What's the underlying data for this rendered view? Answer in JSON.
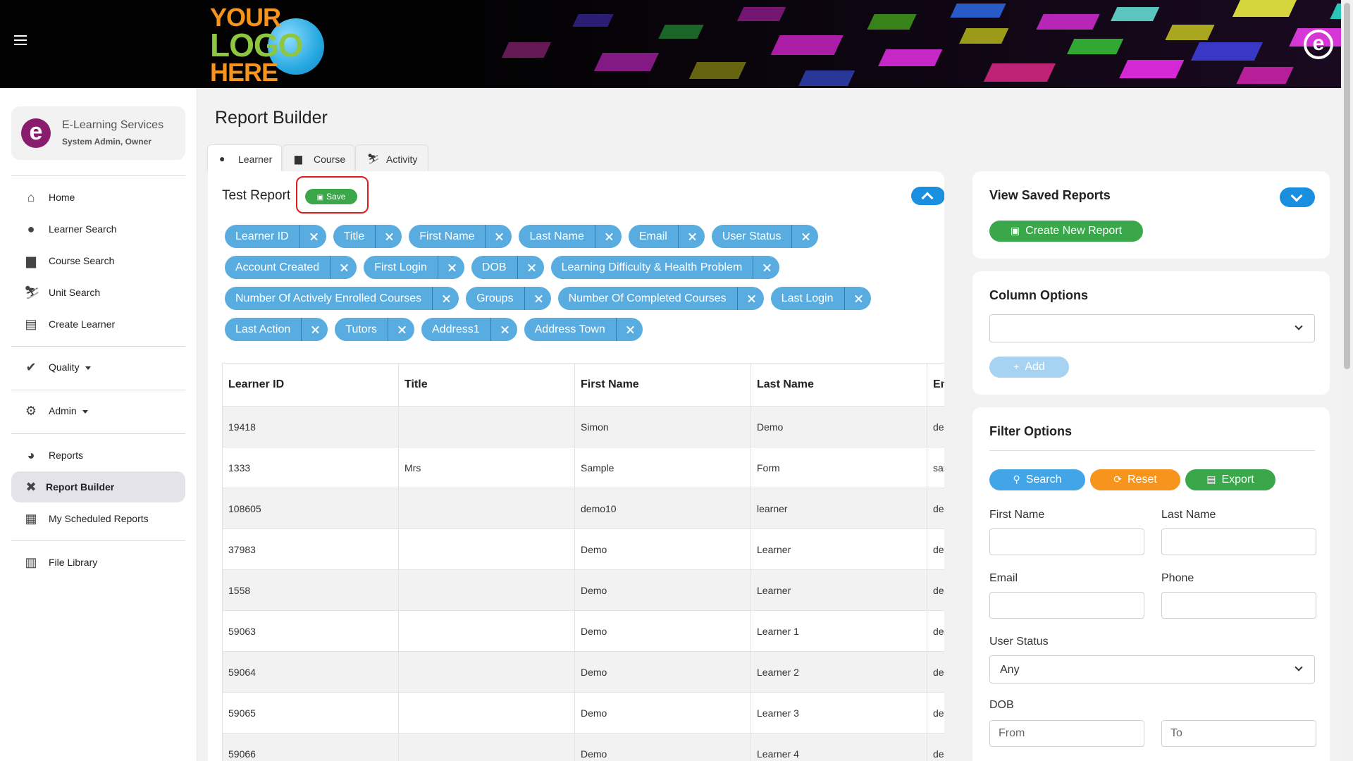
{
  "header": {
    "menu_icon": "hamburger-icon",
    "logo": {
      "line1": "YOUR",
      "line2": "LOGO",
      "line3": "HERE"
    },
    "brand_icon": "e-learning-logo-icon"
  },
  "sidebar": {
    "user": {
      "avatar_letter": "e",
      "org": "E-Learning Services",
      "role": "System Admin, Owner"
    },
    "items": [
      {
        "label": "Home",
        "icon": "home-icon",
        "glyph": "⌂"
      },
      {
        "label": "Learner Search",
        "icon": "user-circle-icon",
        "glyph": "●"
      },
      {
        "label": "Course Search",
        "icon": "teacher-icon",
        "glyph": "▆"
      },
      {
        "label": "Unit Search",
        "icon": "skier-icon",
        "glyph": "⛷"
      },
      {
        "label": "Create Learner",
        "icon": "clipboard-icon",
        "glyph": "▤"
      },
      {
        "label": "Quality",
        "icon": "check-circle-icon",
        "glyph": "✔"
      },
      {
        "label": "Admin",
        "icon": "cogs-icon",
        "glyph": "⚙"
      },
      {
        "label": "Reports",
        "icon": "pie-chart-icon",
        "glyph": "◕"
      },
      {
        "label": "Report Builder",
        "icon": "tools-icon",
        "glyph": "✖"
      },
      {
        "label": "My Scheduled Reports",
        "icon": "calendar-icon",
        "glyph": "▦"
      },
      {
        "label": "File Library",
        "icon": "books-icon",
        "glyph": "▥"
      }
    ]
  },
  "main": {
    "page_title": "Report Builder",
    "tabs": [
      {
        "label": "Learner",
        "icon": "user-circle-icon",
        "glyph": "●"
      },
      {
        "label": "Course",
        "icon": "teacher-icon",
        "glyph": "▆"
      },
      {
        "label": "Activity",
        "icon": "skier-icon",
        "glyph": "⛷"
      }
    ],
    "report": {
      "name": "Test Report",
      "save_label": "Save",
      "save_glyph": "▣",
      "columns_selected": [
        "Learner ID",
        "Title",
        "First Name",
        "Last Name",
        "Email",
        "User Status",
        "Account Created",
        "First Login",
        "DOB",
        "Learning Difficulty & Health Problem",
        "Number Of Actively Enrolled Courses",
        "Groups",
        "Number Of Completed Courses",
        "Last Login",
        "Last Action",
        "Tutors",
        "Address1",
        "Address Town"
      ]
    },
    "table": {
      "headers": [
        "Learner ID",
        "Title",
        "First Name",
        "Last Name",
        "Em"
      ],
      "rows": [
        [
          "19418",
          "",
          "Simon",
          "Demo",
          "der"
        ],
        [
          "1333",
          "Mrs",
          "Sample",
          "Form",
          "sar"
        ],
        [
          "108605",
          "",
          "demo10",
          "learner",
          "der"
        ],
        [
          "37983",
          "",
          "Demo",
          "Learner",
          "der"
        ],
        [
          "1558",
          "",
          "Demo",
          "Learner",
          "der"
        ],
        [
          "59063",
          "",
          "Demo",
          "Learner 1",
          "der"
        ],
        [
          "59064",
          "",
          "Demo",
          "Learner 2",
          "der"
        ],
        [
          "59065",
          "",
          "Demo",
          "Learner 3",
          "der"
        ],
        [
          "59066",
          "",
          "Demo",
          "Learner 4",
          "der"
        ]
      ]
    }
  },
  "right": {
    "saved_reports": {
      "title": "View Saved Reports",
      "create_label": "Create New Report",
      "create_glyph": "▣"
    },
    "column_options": {
      "title": "Column Options",
      "select_value": "",
      "add_label": "Add",
      "add_glyph": "+"
    },
    "filter_options": {
      "title": "Filter Options",
      "search_label": "Search",
      "search_glyph": "⚲",
      "reset_label": "Reset",
      "reset_glyph": "⟳",
      "export_label": "Export",
      "export_glyph": "▤",
      "first_name_label": "First Name",
      "last_name_label": "Last Name",
      "email_label": "Email",
      "phone_label": "Phone",
      "user_status_label": "User Status",
      "user_status_value": "Any",
      "dob_label": "DOB",
      "from_placeholder": "From",
      "to_placeholder": "To"
    }
  },
  "colors": {
    "chip": "#59ace0",
    "save_green": "#3aa84a",
    "search_blue": "#42a5e8",
    "reset_orange": "#f7941d",
    "export_green": "#3aa84a",
    "highlight_red": "#e01b1b",
    "brand_purple": "#8a1c6e"
  }
}
